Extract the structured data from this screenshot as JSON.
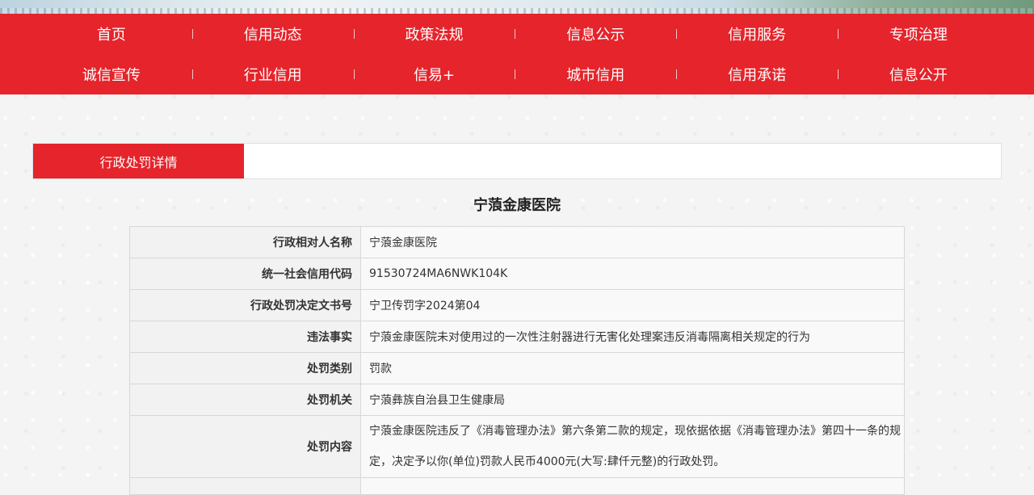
{
  "nav": {
    "row1": [
      "首页",
      "信用动态",
      "政策法规",
      "信息公示",
      "信用服务",
      "专项治理"
    ],
    "row2": [
      "诚信宣传",
      "行业信用",
      "信易+",
      "城市信用",
      "信用承诺",
      "信息公开"
    ]
  },
  "tab": {
    "active_label": "行政处罚详情"
  },
  "page": {
    "title": "宁蒗金康医院"
  },
  "detail": {
    "rows": [
      {
        "label": "行政相对人名称",
        "value": "宁蒗金康医院"
      },
      {
        "label": "统一社会信用代码",
        "value": "91530724MA6NWK104K"
      },
      {
        "label": "行政处罚决定文书号",
        "value": "宁卫传罚字2024第04"
      },
      {
        "label": "违法事实",
        "value": "宁蒗金康医院未对使用过的一次性注射器进行无害化处理案违反消毒隔离相关规定的行为"
      },
      {
        "label": "处罚类别",
        "value": "罚款"
      },
      {
        "label": "处罚机关",
        "value": "宁蒗彝族自治县卫生健康局"
      },
      {
        "label": "处罚内容",
        "value": "宁蒗金康医院违反了《消毒管理办法》第六条第二款的规定，现依据依据《消毒管理办法》第四十一条的规定，决定予以你(单位)罚款人民币4000元(大写:肆仟元整)的行政处罚。"
      }
    ]
  }
}
